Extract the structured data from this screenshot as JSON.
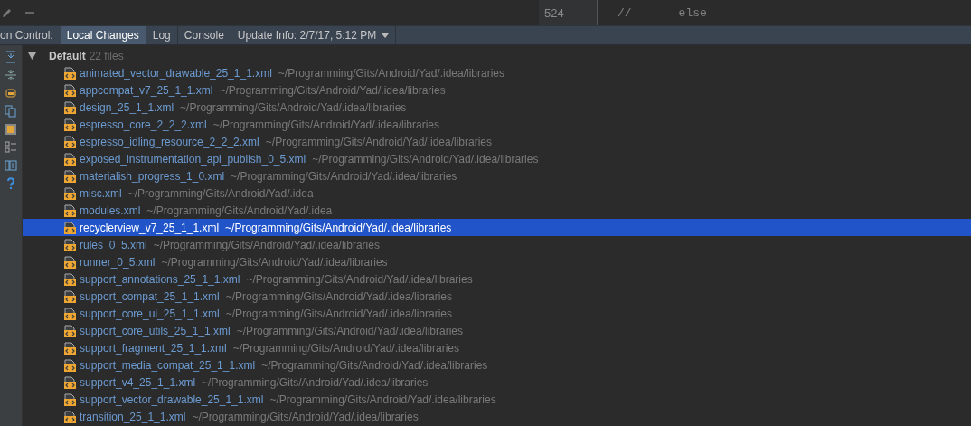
{
  "editor": {
    "line_number": "524",
    "code": [
      {
        "text": "//"
      },
      {
        "text": "else"
      }
    ]
  },
  "tool_window": {
    "title": "on Control:",
    "tabs": [
      {
        "label": "Local Changes",
        "selected": true,
        "dropdown": false
      },
      {
        "label": "Log",
        "selected": false,
        "dropdown": false
      },
      {
        "label": "Console",
        "selected": false,
        "dropdown": false
      },
      {
        "label": "Update Info: 2/7/17, 5:12 PM",
        "selected": false,
        "dropdown": true
      }
    ]
  },
  "changelist": {
    "name": "Default",
    "count": "22 files",
    "expanded": true,
    "files": [
      {
        "name": "animated_vector_drawable_25_1_1.xml",
        "path": "~/Programming/Gits/Android/Yad/.idea/libraries",
        "selected": false
      },
      {
        "name": "appcompat_v7_25_1_1.xml",
        "path": "~/Programming/Gits/Android/Yad/.idea/libraries",
        "selected": false
      },
      {
        "name": "design_25_1_1.xml",
        "path": "~/Programming/Gits/Android/Yad/.idea/libraries",
        "selected": false
      },
      {
        "name": "espresso_core_2_2_2.xml",
        "path": "~/Programming/Gits/Android/Yad/.idea/libraries",
        "selected": false
      },
      {
        "name": "espresso_idling_resource_2_2_2.xml",
        "path": "~/Programming/Gits/Android/Yad/.idea/libraries",
        "selected": false
      },
      {
        "name": "exposed_instrumentation_api_publish_0_5.xml",
        "path": "~/Programming/Gits/Android/Yad/.idea/libraries",
        "selected": false
      },
      {
        "name": "materialish_progress_1_0.xml",
        "path": "~/Programming/Gits/Android/Yad/.idea/libraries",
        "selected": false
      },
      {
        "name": "misc.xml",
        "path": "~/Programming/Gits/Android/Yad/.idea",
        "selected": false
      },
      {
        "name": "modules.xml",
        "path": "~/Programming/Gits/Android/Yad/.idea",
        "selected": false
      },
      {
        "name": "recyclerview_v7_25_1_1.xml",
        "path": "~/Programming/Gits/Android/Yad/.idea/libraries",
        "selected": true
      },
      {
        "name": "rules_0_5.xml",
        "path": "~/Programming/Gits/Android/Yad/.idea/libraries",
        "selected": false
      },
      {
        "name": "runner_0_5.xml",
        "path": "~/Programming/Gits/Android/Yad/.idea/libraries",
        "selected": false
      },
      {
        "name": "support_annotations_25_1_1.xml",
        "path": "~/Programming/Gits/Android/Yad/.idea/libraries",
        "selected": false
      },
      {
        "name": "support_compat_25_1_1.xml",
        "path": "~/Programming/Gits/Android/Yad/.idea/libraries",
        "selected": false
      },
      {
        "name": "support_core_ui_25_1_1.xml",
        "path": "~/Programming/Gits/Android/Yad/.idea/libraries",
        "selected": false
      },
      {
        "name": "support_core_utils_25_1_1.xml",
        "path": "~/Programming/Gits/Android/Yad/.idea/libraries",
        "selected": false
      },
      {
        "name": "support_fragment_25_1_1.xml",
        "path": "~/Programming/Gits/Android/Yad/.idea/libraries",
        "selected": false
      },
      {
        "name": "support_media_compat_25_1_1.xml",
        "path": "~/Programming/Gits/Android/Yad/.idea/libraries",
        "selected": false
      },
      {
        "name": "support_v4_25_1_1.xml",
        "path": "~/Programming/Gits/Android/Yad/.idea/libraries",
        "selected": false
      },
      {
        "name": "support_vector_drawable_25_1_1.xml",
        "path": "~/Programming/Gits/Android/Yad/.idea/libraries",
        "selected": false
      },
      {
        "name": "transition_25_1_1.xml",
        "path": "~/Programming/Gits/Android/Yad/.idea/libraries",
        "selected": false
      }
    ]
  }
}
